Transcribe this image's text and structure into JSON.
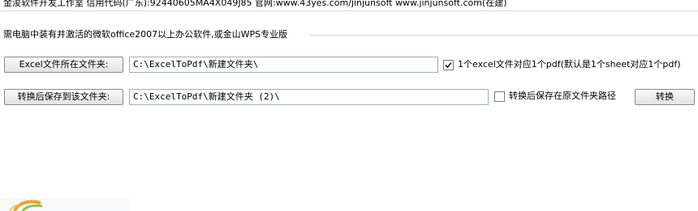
{
  "header": {
    "text": "金浚软件开发工作室 信用代码(广东):92440605MA4X049J85 官网:www.43yes.com/jinjunsoft  www.jinjunsoft.com(在建)"
  },
  "group": {
    "title": "需电脑中装有并激活的微软office2007以上办公软件,或金山WPS专业版"
  },
  "row1": {
    "button_label": "Excel文件所在文件夹:",
    "path_value": "C:\\ExcelToPdf\\新建文件夹\\",
    "checkbox_checked": true,
    "checkbox_label": "1个excel文件对应1个pdf(默认是1个sheet对应1个pdf)"
  },
  "row2": {
    "button_label": "转换后保存到该文件夹:",
    "path_value": "C:\\ExcelToPdf\\新建文件夹 (2)\\",
    "checkbox_checked": false,
    "checkbox_label": "转换后保存在原文件夹路径",
    "convert_label": "转换"
  },
  "colors": {
    "button_border": "#8a8a8a",
    "input_border": "#a5acb5",
    "logo_orange": "#f0a030",
    "logo_green": "#8cc63f"
  },
  "icons": {
    "checkmark": "check-icon",
    "logo": "logo-swirl-icon"
  }
}
